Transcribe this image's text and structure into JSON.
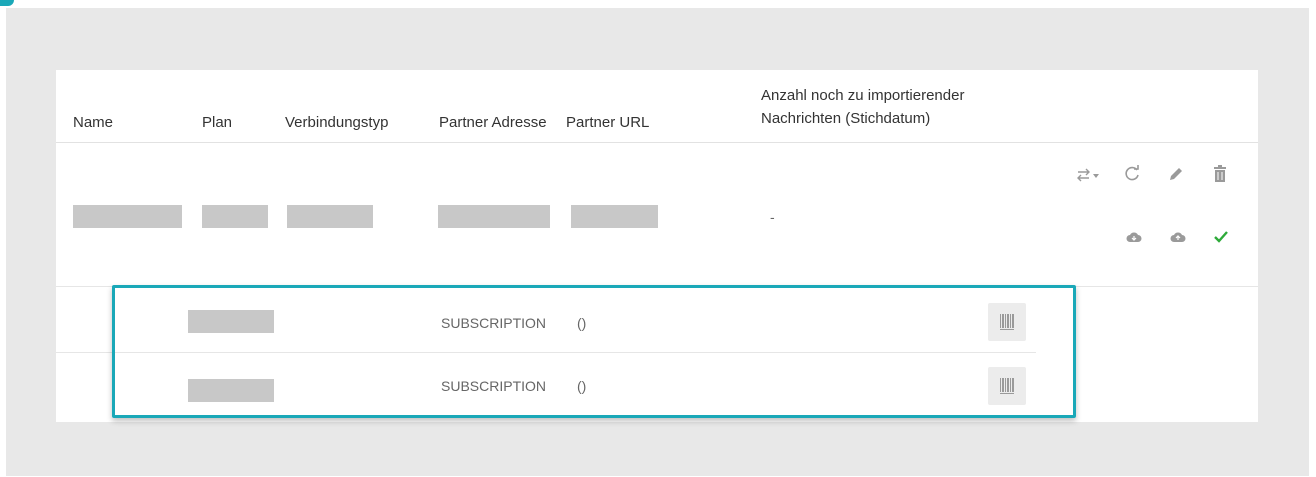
{
  "table": {
    "headers": {
      "name": "Name",
      "plan": "Plan",
      "connection_type": "Verbindungstyp",
      "partner_address": "Partner Adresse",
      "partner_url": "Partner URL",
      "pending_messages_line1": "Anzahl noch zu importierender",
      "pending_messages_line2": "Nachrichten (Stichdatum)"
    },
    "main_row": {
      "pending_messages": "-"
    },
    "sub_rows": [
      {
        "type": "SUBSCRIPTION",
        "value": "()"
      },
      {
        "type": "SUBSCRIPTION",
        "value": "()"
      }
    ]
  },
  "icons": {
    "swap": "swap-arrows-icon",
    "refresh": "refresh-icon",
    "edit": "pencil-icon",
    "delete": "trash-icon",
    "download": "cloud-download-icon",
    "upload": "cloud-upload-icon",
    "confirm": "checkmark-icon",
    "barcode": "barcode-icon"
  },
  "colors": {
    "accent": "#1aa8b8",
    "icon_gray": "#9a9a9a",
    "check_green": "#2eaa3a",
    "redacted": "#c8c8c8"
  }
}
